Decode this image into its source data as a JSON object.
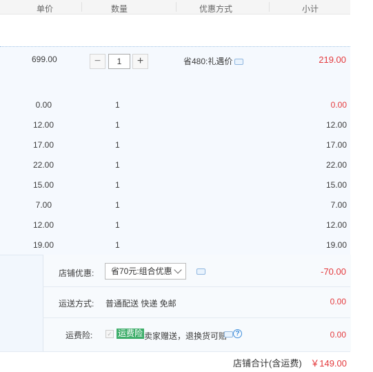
{
  "header": {
    "unit_price": "单价",
    "quantity": "数量",
    "discount": "优惠方式",
    "subtotal": "小计"
  },
  "main_item": {
    "price": "699.00",
    "quantity": "1",
    "discount": "省480:礼遇价",
    "subtotal": "219.00",
    "minus": "−",
    "plus": "+"
  },
  "items": [
    {
      "price": "0.00",
      "qty": "1",
      "subtotal": "0.00"
    },
    {
      "price": "12.00",
      "qty": "1",
      "subtotal": "12.00"
    },
    {
      "price": "17.00",
      "qty": "1",
      "subtotal": "17.00"
    },
    {
      "price": "22.00",
      "qty": "1",
      "subtotal": "22.00"
    },
    {
      "price": "15.00",
      "qty": "1",
      "subtotal": "15.00"
    },
    {
      "price": "7.00",
      "qty": "1",
      "subtotal": "7.00"
    },
    {
      "price": "12.00",
      "qty": "1",
      "subtotal": "12.00"
    },
    {
      "price": "19.00",
      "qty": "1",
      "subtotal": "19.00"
    }
  ],
  "shop": {
    "promo_label": "店铺优惠:",
    "promo_select": "省70元:组合优惠",
    "promo_amount": "-70.00",
    "shipping_label": "运送方式:",
    "shipping_value": "普通配送 快递 免邮",
    "shipping_amount": "0.00",
    "insurance_label": "运费险:",
    "insurance_check": "✓",
    "insurance_tag": "运费险",
    "insurance_desc": "卖家赠送，退换货可赔",
    "insurance_help": "?",
    "insurance_amount": "0.00",
    "total_label": "店铺合计(含运费)",
    "total_amount": "￥149.00"
  },
  "colors": {
    "price_red": "#e4393c",
    "tag_green": "#3fae6b",
    "link_blue": "#3d8ddb"
  }
}
